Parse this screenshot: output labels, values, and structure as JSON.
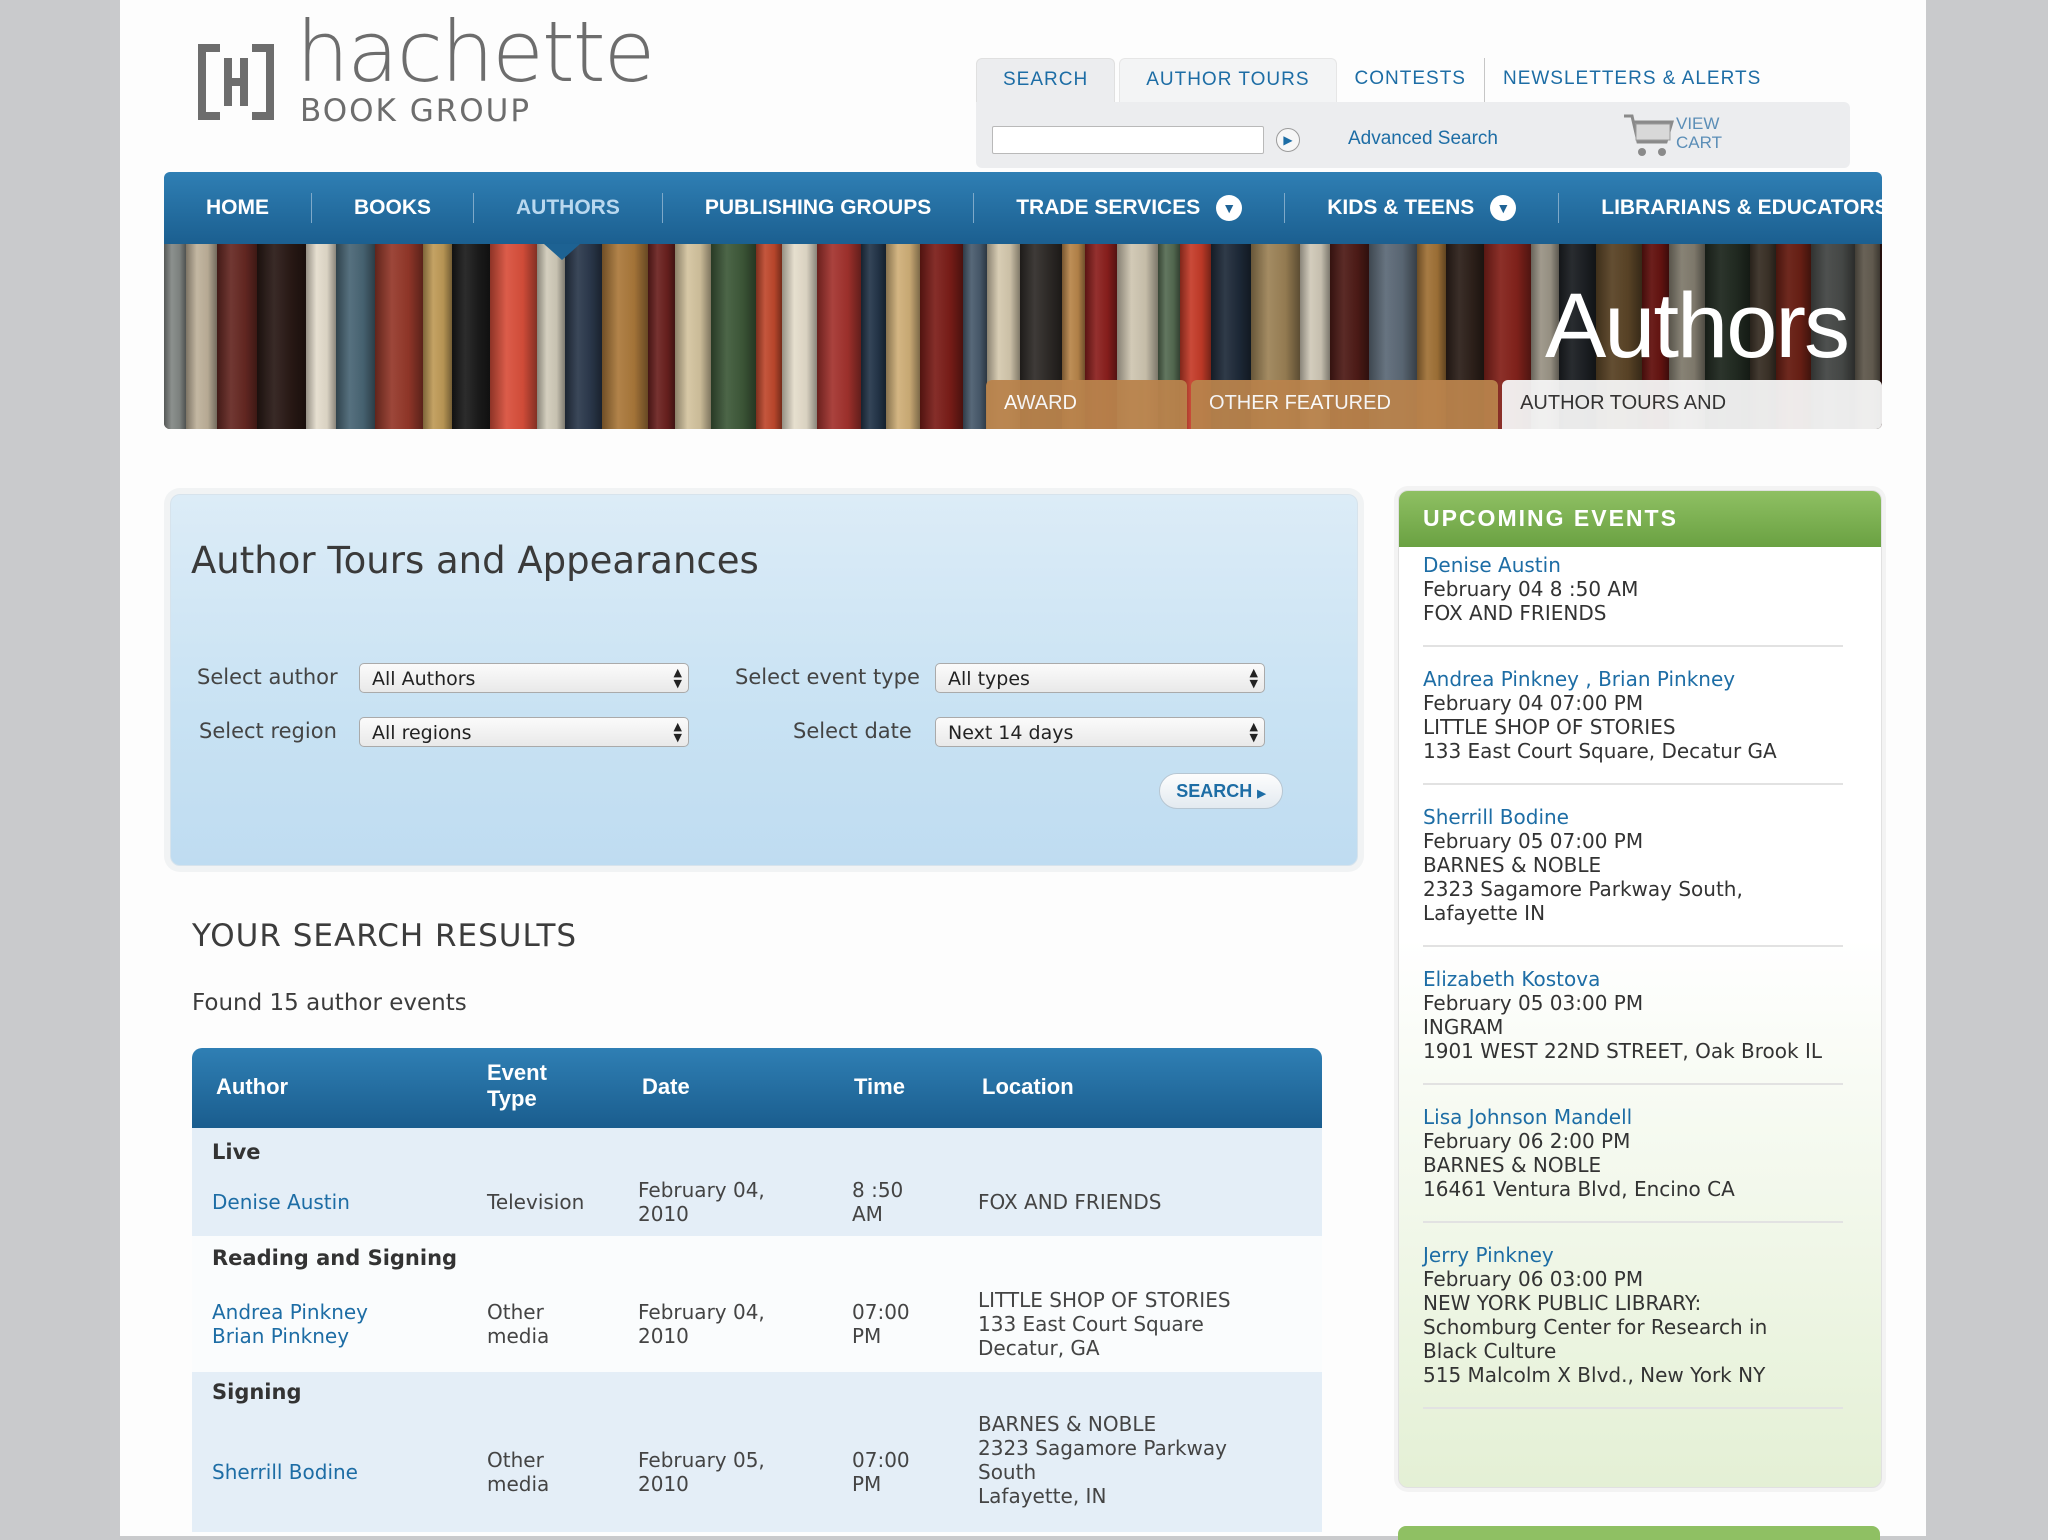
{
  "brand": {
    "name": "hachette",
    "subtitle": "BOOK GROUP"
  },
  "top_tabs": [
    {
      "label": "SEARCH"
    },
    {
      "label": "AUTHOR TOURS"
    },
    {
      "label": "CONTESTS"
    },
    {
      "label": "NEWSLETTERS & ALERTS"
    }
  ],
  "search": {
    "placeholder": "",
    "advanced_label": "Advanced Search",
    "cart_label": "VIEW CART"
  },
  "main_nav": [
    {
      "label": "HOME"
    },
    {
      "label": "BOOKS"
    },
    {
      "label": "AUTHORS"
    },
    {
      "label": "PUBLISHING GROUPS"
    },
    {
      "label": "TRADE SERVICES"
    },
    {
      "label": "KIDS & TEENS"
    },
    {
      "label": "LIBRARIANS & EDUCATORS"
    }
  ],
  "banner": {
    "title": "Authors",
    "tabs": [
      {
        "label": "AWARD WINNERS"
      },
      {
        "label": "OTHER FEATURED AUTHORS"
      },
      {
        "label": "AUTHOR TOURS AND APPEARANCES"
      }
    ],
    "spines": [
      "#8a8f8c",
      "#c9bba3",
      "#6b2a24",
      "#2b1a16",
      "#efe7d6",
      "#4c6a7a",
      "#9b3a2b",
      "#c7a15b",
      "#1c1c1c",
      "#e1523d",
      "#d8d2c0",
      "#2c3a4e",
      "#b07c3c",
      "#6e2220",
      "#d9c9a3",
      "#3f5b3a",
      "#c44a2e",
      "#e9e1cf",
      "#a6332e",
      "#24364a",
      "#d3b27a",
      "#7d1d18",
      "#4a5c6e",
      "#d7cbb0",
      "#2e2a27",
      "#b9864a",
      "#8c1f1d",
      "#cfc6b1",
      "#556b52",
      "#c53b28",
      "#1f2b3b",
      "#a78b5c",
      "#e7dfcc",
      "#5a1f1a",
      "#6f7f8f",
      "#c98f45",
      "#3b2a22",
      "#b42f25",
      "#dcd3bf",
      "#2a2f35",
      "#8d6a3c",
      "#a21f1a",
      "#d8cfb8",
      "#3a4a3a",
      "#6b5a48",
      "#c33a26"
    ]
  },
  "panel": {
    "title": "Author Tours and Appearances",
    "author_label": "Select author",
    "author_value": "All Authors",
    "event_label": "Select event type",
    "event_value": "All types",
    "region_label": "Select region",
    "region_value": "All regions",
    "date_label": "Select date",
    "date_value": "Next 14 days",
    "search_label": "SEARCH"
  },
  "results": {
    "heading": "YOUR SEARCH RESULTS",
    "found": "Found 15 author events",
    "columns": {
      "author": "Author",
      "event_type_1": "Event",
      "event_type_2": "Type",
      "date": "Date",
      "time": "Time",
      "location": "Location"
    },
    "groups": [
      {
        "title": "Live",
        "author_1": "Denise Austin",
        "author_2": "",
        "type_1": "Television",
        "type_2": "",
        "date_1": "February 04,",
        "date_2": "2010",
        "time_1": "8 :50",
        "time_2": "AM",
        "loc_1": "FOX AND FRIENDS",
        "loc_2": "",
        "loc_3": "",
        "loc_4": ""
      },
      {
        "title": "Reading and Signing",
        "author_1": "Andrea Pinkney",
        "author_2": "Brian Pinkney",
        "type_1": "Other",
        "type_2": "media",
        "date_1": "February 04,",
        "date_2": "2010",
        "time_1": "07:00",
        "time_2": "PM",
        "loc_1": "LITTLE SHOP OF STORIES",
        "loc_2": "133 East Court Square",
        "loc_3": "Decatur, GA",
        "loc_4": ""
      },
      {
        "title": "Signing",
        "author_1": "Sherrill Bodine",
        "author_2": "",
        "type_1": "Other",
        "type_2": "media",
        "date_1": "February 05,",
        "date_2": "2010",
        "time_1": "07:00",
        "time_2": "PM",
        "loc_1": "BARNES & NOBLE",
        "loc_2": "2323 Sagamore Parkway",
        "loc_3": "South",
        "loc_4": "Lafayette, IN"
      }
    ]
  },
  "sidebar": {
    "title": "UPCOMING EVENTS",
    "events": [
      {
        "name": "Denise Austin",
        "when": "February 04 8 :50 AM",
        "lines": [
          "FOX AND FRIENDS"
        ]
      },
      {
        "name": "Andrea Pinkney , Brian Pinkney",
        "when": "February 04 07:00 PM",
        "lines": [
          "LITTLE SHOP OF STORIES",
          "133 East Court Square, Decatur GA"
        ]
      },
      {
        "name": "Sherrill Bodine",
        "when": "February 05 07:00 PM",
        "lines": [
          "BARNES & NOBLE",
          "2323 Sagamore Parkway South,",
          "Lafayette IN"
        ]
      },
      {
        "name": "Elizabeth Kostova",
        "when": "February 05 03:00 PM",
        "lines": [
          "INGRAM",
          "1901 WEST 22ND STREET, Oak Brook IL"
        ]
      },
      {
        "name": "Lisa Johnson Mandell",
        "when": "February 06 2:00 PM",
        "lines": [
          "BARNES & NOBLE",
          "16461 Ventura Blvd, Encino CA"
        ]
      },
      {
        "name": "Jerry Pinkney",
        "when": "February 06 03:00 PM",
        "lines": [
          "NEW YORK PUBLIC LIBRARY:",
          "Schomburg Center for Research in",
          "Black Culture",
          "515 Malcolm X Blvd., New York NY"
        ]
      }
    ]
  },
  "icons": {
    "logo": "hachette-logo-icon",
    "go": "arrow-right-icon",
    "cart": "shopping-cart-icon",
    "dropdown": "chevron-down-icon"
  },
  "colors": {
    "nav_blue": "#1f6396",
    "link_blue": "#1d6da5",
    "tab_orange": "#b9834c",
    "sidebar_green": "#7cb150"
  }
}
